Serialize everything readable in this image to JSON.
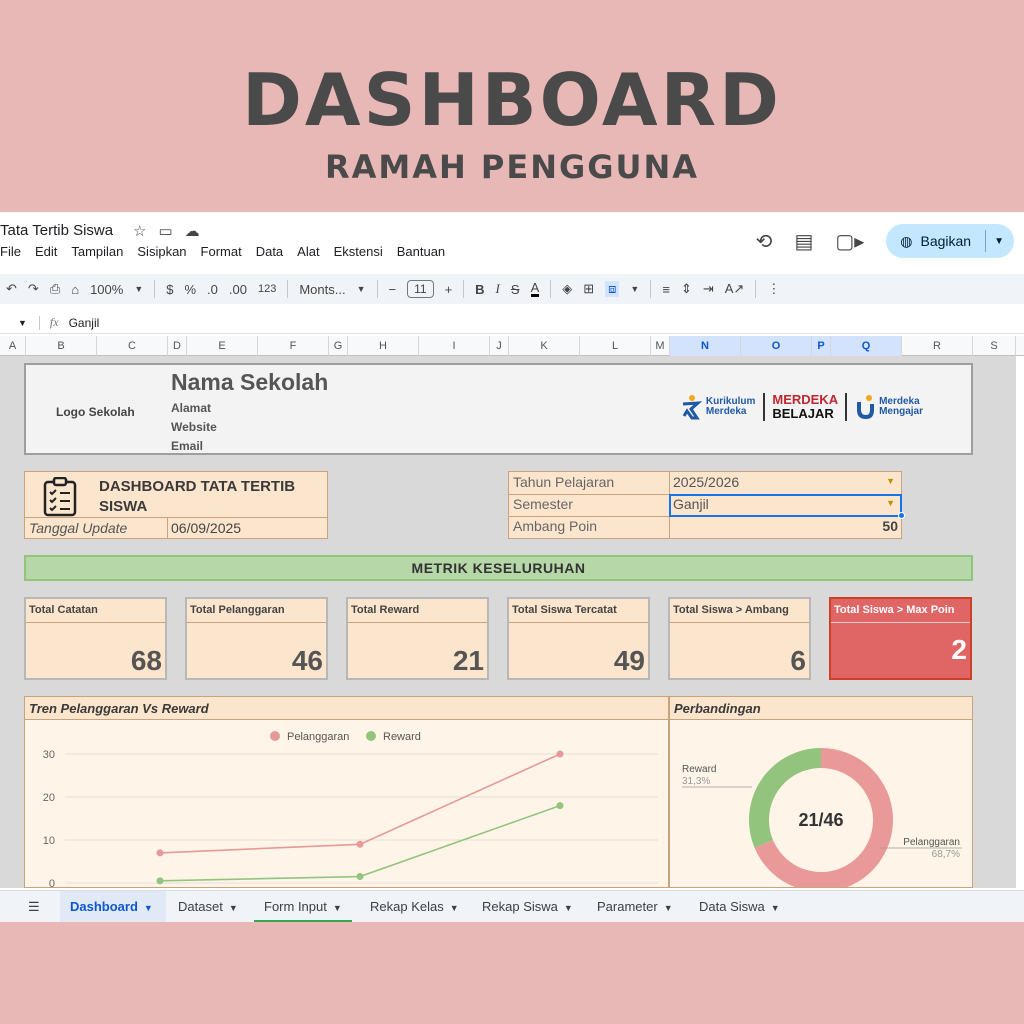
{
  "hero": {
    "title": "DASHBOARD",
    "subtitle": "RAMAH PENGGUNA"
  },
  "app": {
    "doc_title": "Tata Tertib Siswa",
    "menu": [
      "File",
      "Edit",
      "Tampilan",
      "Sisipkan",
      "Format",
      "Data",
      "Alat",
      "Ekstensi",
      "Bantuan"
    ],
    "share_label": "Bagikan",
    "toolbar": {
      "zoom": "100%",
      "currency": "$",
      "percent": "%",
      "dec_less": ".0",
      "dec_more": ".00",
      "number_format": "123",
      "font": "Monts...",
      "font_size": "11"
    },
    "formula": {
      "fx": "fx",
      "value": "Ganjil"
    },
    "columns": [
      "A",
      "B",
      "C",
      "D",
      "E",
      "F",
      "G",
      "H",
      "I",
      "J",
      "K",
      "L",
      "M",
      "N",
      "O",
      "P",
      "Q",
      "R",
      "S"
    ]
  },
  "school": {
    "logo_label": "Logo Sekolah",
    "name": "Nama Sekolah",
    "address": "Alamat",
    "website": "Website",
    "email": "Email",
    "logos": {
      "kurikulum_1": "Kurikulum",
      "kurikulum_2": "Merdeka",
      "mb_1": "MERDEKA",
      "mb_2": "BELAJAR",
      "mm_1": "Merdeka",
      "mm_2": "Mengajar"
    }
  },
  "dashboard": {
    "title": "DASHBOARD TATA TERTIB SISWA",
    "update_label": "Tanggal Update",
    "update_value": "06/09/2025"
  },
  "params": {
    "year_label": "Tahun Pelajaran",
    "year_value": "2025/2026",
    "semester_label": "Semester",
    "semester_value": "Ganjil",
    "threshold_label": "Ambang Poin",
    "threshold_value": "50"
  },
  "metrics_header": "METRIK KESELURUHAN",
  "metrics": [
    {
      "label": "Total Catatan",
      "value": "68"
    },
    {
      "label": "Total Pelanggaran",
      "value": "46"
    },
    {
      "label": "Total Reward",
      "value": "21"
    },
    {
      "label": "Total Siswa Tercatat",
      "value": "49"
    },
    {
      "label": "Total Siswa > Ambang",
      "value": "6"
    },
    {
      "label": "Total Siswa > Max Poin",
      "value": "2"
    }
  ],
  "trend": {
    "title": "Tren Pelanggaran Vs Reward",
    "legend_a": "Pelanggaran",
    "legend_b": "Reward",
    "y_ticks": [
      "30",
      "20",
      "10",
      "0"
    ]
  },
  "compare": {
    "title": "Perbandingan",
    "center": "21/46",
    "reward_label": "Reward",
    "reward_pct": "31,3%",
    "violation_label": "Pelanggaran",
    "violation_pct": "68,7%"
  },
  "chart_data": [
    {
      "type": "line",
      "title": "Tren Pelanggaran Vs Reward",
      "ylim": [
        0,
        30
      ],
      "y_ticks": [
        0,
        10,
        20,
        30
      ],
      "series": [
        {
          "name": "Pelanggaran",
          "color": "#e69999",
          "values": [
            7,
            9,
            30
          ]
        },
        {
          "name": "Reward",
          "color": "#93c47d",
          "values": [
            0.5,
            1.5,
            18
          ]
        }
      ],
      "legend": "top"
    },
    {
      "type": "pie",
      "title": "Perbandingan",
      "slices": [
        {
          "name": "Pelanggaran",
          "value": 68.7,
          "color": "#ea9999"
        },
        {
          "name": "Reward",
          "value": 31.3,
          "color": "#93c47d"
        }
      ]
    }
  ],
  "tabs": [
    "Dashboard",
    "Dataset",
    "Form Input",
    "Rekap Kelas",
    "Rekap Siswa",
    "Parameter",
    "Data Siswa"
  ]
}
